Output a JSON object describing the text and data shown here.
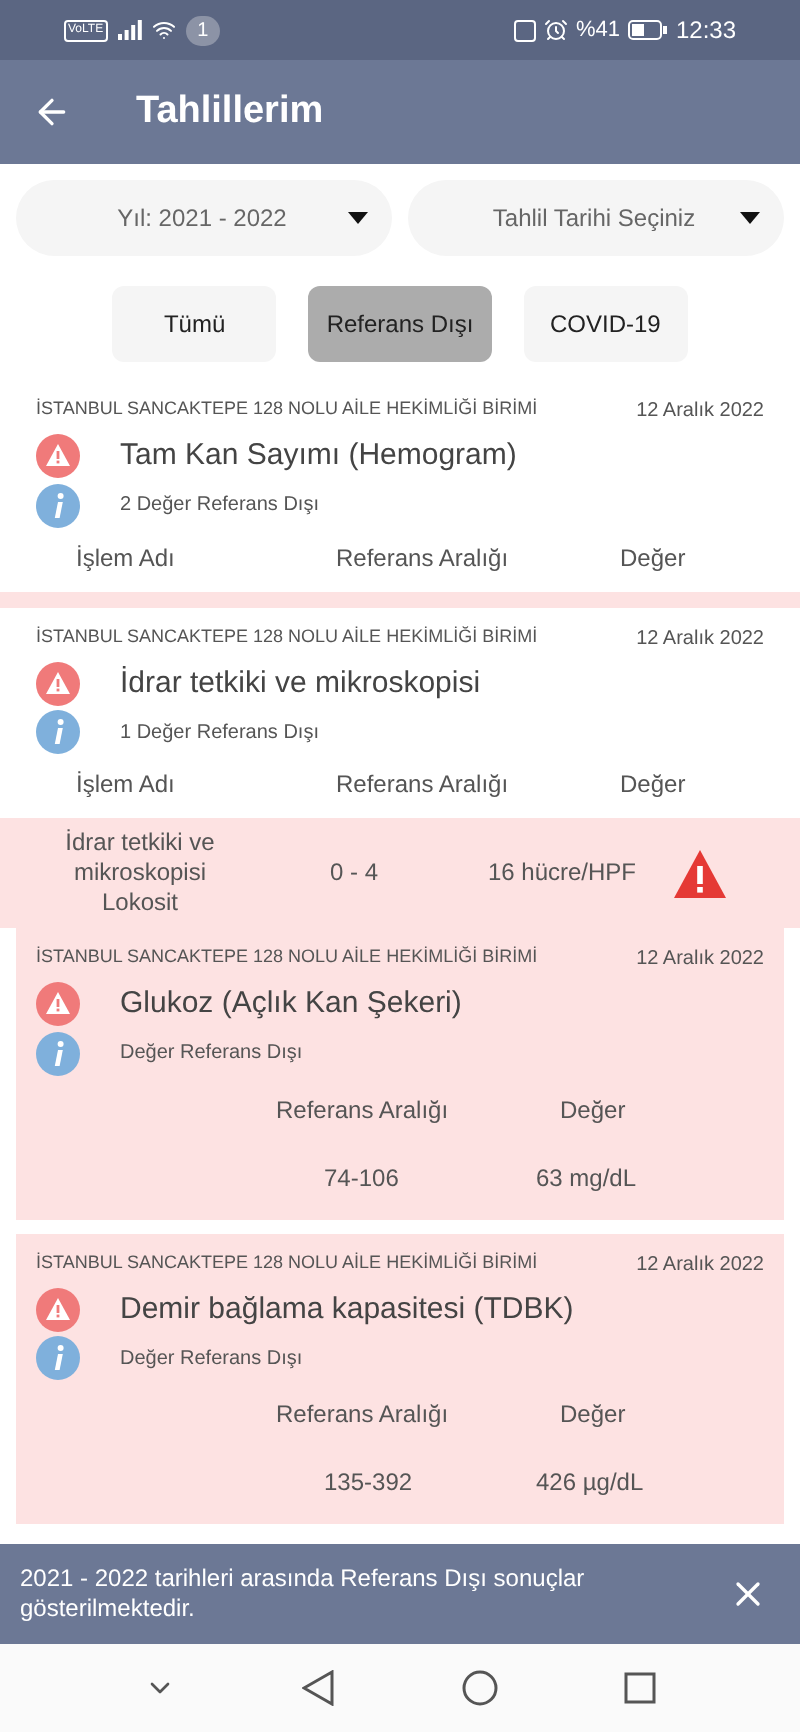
{
  "status_bar": {
    "network": "VoLTE",
    "notification_count": "1",
    "battery": "%41",
    "time": "12:33"
  },
  "header": {
    "title": "Tahlillerim"
  },
  "dropdowns": [
    {
      "label": "Yıl: 2021 - 2022"
    },
    {
      "label": "Tahlil Tarihi Seçiniz"
    }
  ],
  "filters": [
    {
      "label": "Tümü",
      "selected": false
    },
    {
      "label": "Referans Dışı",
      "selected": true
    },
    {
      "label": "COVID-19",
      "selected": false
    }
  ],
  "results": [
    {
      "kind": "table",
      "facility": "İSTANBUL SANCAKTEPE 128 NOLU AİLE HEKİMLİĞİ BİRİMİ",
      "date": "12 Aralık 2022",
      "test": "Tam Kan Sayımı (Hemogram)",
      "summary": "2 Değer Referans Dışı",
      "columns": [
        "İşlem Adı",
        "Referans Aralığı",
        "Değer"
      ]
    },
    {
      "kind": "table",
      "facility": "İSTANBUL SANCAKTEPE 128 NOLU AİLE HEKİMLİĞİ BİRİMİ",
      "date": "12 Aralık 2022",
      "test": "İdrar tetkiki ve mikroskopisi",
      "summary": "1 Değer Referans Dışı",
      "columns": [
        "İşlem Adı",
        "Referans Aralığı",
        "Değer"
      ],
      "rows": [
        {
          "name": "İdrar tetkiki ve mikroskopisi Lokosit",
          "range": "0 - 4",
          "value": "16 hücre/HPF",
          "flagged": true
        }
      ]
    },
    {
      "kind": "single",
      "facility": "İSTANBUL SANCAKTEPE 128 NOLU AİLE HEKİMLİĞİ BİRİMİ",
      "date": "12 Aralık 2022",
      "test": "Glukoz (Açlık Kan Şekeri)",
      "summary": "Değer Referans Dışı",
      "columns": [
        "Referans Aralığı",
        "Değer"
      ],
      "range": "74-106",
      "value": "63 mg/dL"
    },
    {
      "kind": "single",
      "facility": "İSTANBUL SANCAKTEPE 128 NOLU AİLE HEKİMLİĞİ BİRİMİ",
      "date": "12 Aralık 2022",
      "test": "Demir bağlama kapasitesi (TDBK)",
      "summary": "Değer Referans Dışı",
      "columns": [
        "Referans Aralığı",
        "Değer"
      ],
      "range": "135-392",
      "value": "426 µg/dL"
    }
  ],
  "snackbar": {
    "message": "2021 - 2022 tarihleri arasında Referans Dışı sonuçlar gösterilmektedir."
  }
}
